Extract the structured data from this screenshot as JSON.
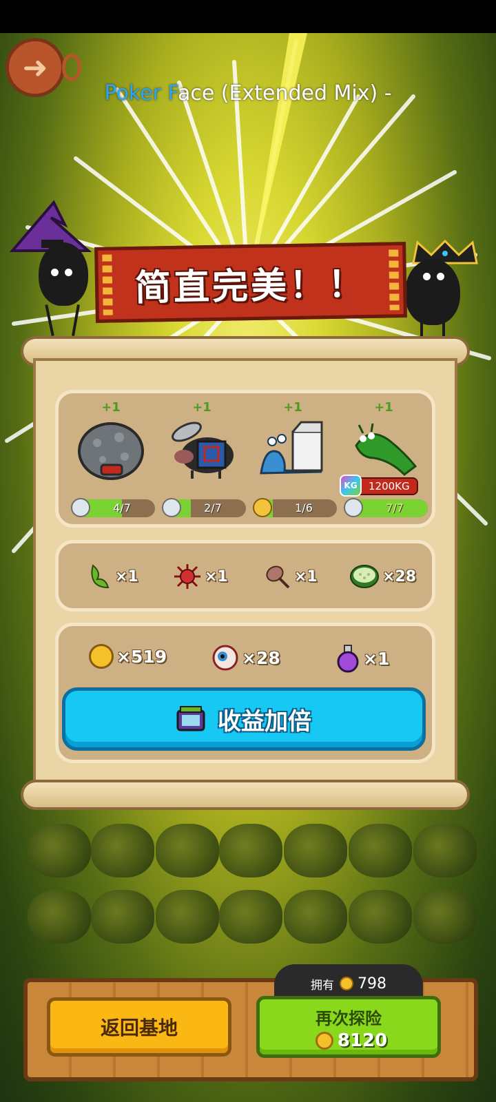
{
  "header": {
    "song_highlight": "Poker F",
    "song_rest": "ace (Extended Mix) -"
  },
  "banner": {
    "title": "简直完美！！"
  },
  "monsters": [
    {
      "name_icon": "rock-monster",
      "bonus": "+1",
      "level": "4/7",
      "fill": 0.57
    },
    {
      "name_icon": "chainsaw-boar",
      "bonus": "+1",
      "level": "2/7",
      "fill": 0.29
    },
    {
      "name_icon": "milk-snail",
      "bonus": "+1",
      "level": "1/6",
      "fill": 0.17
    },
    {
      "name_icon": "green-caterpillar",
      "bonus": "+1",
      "level": "7/7",
      "fill": 1.0,
      "weight": "1200KG",
      "weight_badge": "KG"
    }
  ],
  "materials": [
    {
      "icon": "herb-icon",
      "qty": "×1"
    },
    {
      "icon": "red-spiky-icon",
      "qty": "×1"
    },
    {
      "icon": "mace-icon",
      "qty": "×1"
    },
    {
      "icon": "cucumber-slice-icon",
      "qty": "×28"
    }
  ],
  "rewards": [
    {
      "icon": "coin-icon",
      "qty": "×519"
    },
    {
      "icon": "eyeball-icon",
      "qty": "×28"
    },
    {
      "icon": "potion-icon",
      "qty": "×1"
    }
  ],
  "double_button": {
    "label": "收益加倍",
    "icon": "tv-ad-icon"
  },
  "footer": {
    "owned_label": "拥有",
    "owned_value": "798",
    "home_button": "返回基地",
    "again_button": "再次探险",
    "again_cost": "8120"
  },
  "colors": {
    "double_button": "#18c8f4",
    "home_button": "#fbb714",
    "again_button": "#8ad81c",
    "banner": "#c0321c"
  }
}
